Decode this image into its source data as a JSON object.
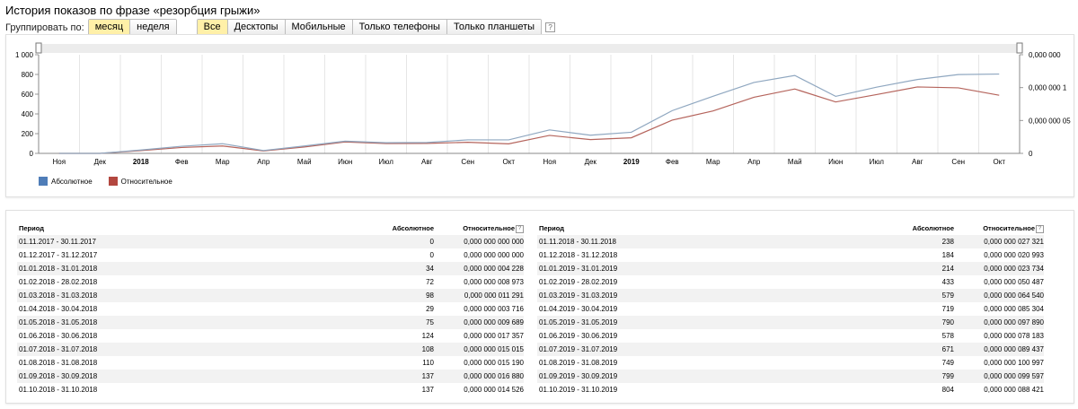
{
  "page": {
    "title": "История показов по фразе «резорбция грыжи»"
  },
  "controls": {
    "group_label": "Группировать по:",
    "period_buttons": [
      {
        "label": "месяц",
        "active": true
      },
      {
        "label": "неделя",
        "active": false
      }
    ],
    "device_buttons": [
      {
        "label": "Все",
        "active": true
      },
      {
        "label": "Десктопы",
        "active": false
      },
      {
        "label": "Мобильные",
        "active": false
      },
      {
        "label": "Только телефоны",
        "active": false
      },
      {
        "label": "Только планшеты",
        "active": false
      }
    ],
    "help": "?"
  },
  "colors": {
    "absolute": "#4f7db8",
    "relative": "#b3473f",
    "abs_line": "#8fa7c0",
    "rel_line": "#b5645c"
  },
  "chart_data": {
    "type": "line",
    "categories": [
      "Ноя",
      "Дек",
      "2018",
      "Фев",
      "Мар",
      "Апр",
      "Май",
      "Июн",
      "Июл",
      "Авг",
      "Сен",
      "Окт",
      "Ноя",
      "Дек",
      "2019",
      "Фев",
      "Мар",
      "Апр",
      "Май",
      "Июн",
      "Июл",
      "Авг",
      "Сен",
      "Окт"
    ],
    "bold_categories": [
      "2018",
      "2019"
    ],
    "series": [
      {
        "name": "Абсолютное",
        "axis": "left",
        "values": [
          0,
          0,
          34,
          72,
          98,
          29,
          75,
          124,
          108,
          110,
          137,
          137,
          238,
          184,
          214,
          433,
          579,
          719,
          790,
          578,
          671,
          749,
          799,
          804
        ]
      },
      {
        "name": "Относительное",
        "axis": "right",
        "values": [
          0,
          0,
          4.228e-09,
          8.973e-09,
          1.1291e-08,
          3.716e-09,
          9.689e-09,
          1.7357e-08,
          1.5015e-08,
          1.519e-08,
          1.688e-08,
          1.4526e-08,
          2.7321e-08,
          2.0993e-08,
          2.3734e-08,
          5.0487e-08,
          6.454e-08,
          8.5304e-08,
          9.789e-08,
          7.8183e-08,
          8.9437e-08,
          1.00997e-07,
          9.9597e-08,
          8.8421e-08
        ]
      }
    ],
    "left_ticks": [
      {
        "value": 0,
        "label": "0"
      },
      {
        "value": 200,
        "label": "200"
      },
      {
        "value": 400,
        "label": "400"
      },
      {
        "value": 600,
        "label": "600"
      },
      {
        "value": 800,
        "label": "800"
      },
      {
        "value": 1000,
        "label": "1 000"
      }
    ],
    "right_ticks": [
      {
        "value": 0,
        "label": "0"
      },
      {
        "value": 5e-08,
        "label": "0,000 000 05"
      },
      {
        "value": 1e-07,
        "label": "0,000 000 1"
      },
      {
        "value": 1.5e-07,
        "label": "0,000 000"
      }
    ],
    "ylim_left": [
      0,
      1000
    ],
    "ylim_right": [
      0,
      1.5e-07
    ],
    "grid": true,
    "legend_position": "bottom-left"
  },
  "table": {
    "headers": {
      "period": "Период",
      "absolute": "Абсолютное",
      "relative": "Относительное"
    },
    "left": [
      [
        "01.11.2017 - 30.11.2017",
        "0",
        "0,000 000 000 000"
      ],
      [
        "01.12.2017 - 31.12.2017",
        "0",
        "0,000 000 000 000"
      ],
      [
        "01.01.2018 - 31.01.2018",
        "34",
        "0,000 000 004 228"
      ],
      [
        "01.02.2018 - 28.02.2018",
        "72",
        "0,000 000 008 973"
      ],
      [
        "01.03.2018 - 31.03.2018",
        "98",
        "0,000 000 011 291"
      ],
      [
        "01.04.2018 - 30.04.2018",
        "29",
        "0,000 000 003 716"
      ],
      [
        "01.05.2018 - 31.05.2018",
        "75",
        "0,000 000 009 689"
      ],
      [
        "01.06.2018 - 30.06.2018",
        "124",
        "0,000 000 017 357"
      ],
      [
        "01.07.2018 - 31.07.2018",
        "108",
        "0,000 000 015 015"
      ],
      [
        "01.08.2018 - 31.08.2018",
        "110",
        "0,000 000 015 190"
      ],
      [
        "01.09.2018 - 30.09.2018",
        "137",
        "0,000 000 016 880"
      ],
      [
        "01.10.2018 - 31.10.2018",
        "137",
        "0,000 000 014 526"
      ]
    ],
    "right": [
      [
        "01.11.2018 - 30.11.2018",
        "238",
        "0,000 000 027 321"
      ],
      [
        "01.12.2018 - 31.12.2018",
        "184",
        "0,000 000 020 993"
      ],
      [
        "01.01.2019 - 31.01.2019",
        "214",
        "0,000 000 023 734"
      ],
      [
        "01.02.2019 - 28.02.2019",
        "433",
        "0,000 000 050 487"
      ],
      [
        "01.03.2019 - 31.03.2019",
        "579",
        "0,000 000 064 540"
      ],
      [
        "01.04.2019 - 30.04.2019",
        "719",
        "0,000 000 085 304"
      ],
      [
        "01.05.2019 - 31.05.2019",
        "790",
        "0,000 000 097 890"
      ],
      [
        "01.06.2019 - 30.06.2019",
        "578",
        "0,000 000 078 183"
      ],
      [
        "01.07.2019 - 31.07.2019",
        "671",
        "0,000 000 089 437"
      ],
      [
        "01.08.2019 - 31.08.2019",
        "749",
        "0,000 000 100 997"
      ],
      [
        "01.09.2019 - 30.09.2019",
        "799",
        "0,000 000 099 597"
      ],
      [
        "01.10.2019 - 31.10.2019",
        "804",
        "0,000 000 088 421"
      ]
    ]
  }
}
